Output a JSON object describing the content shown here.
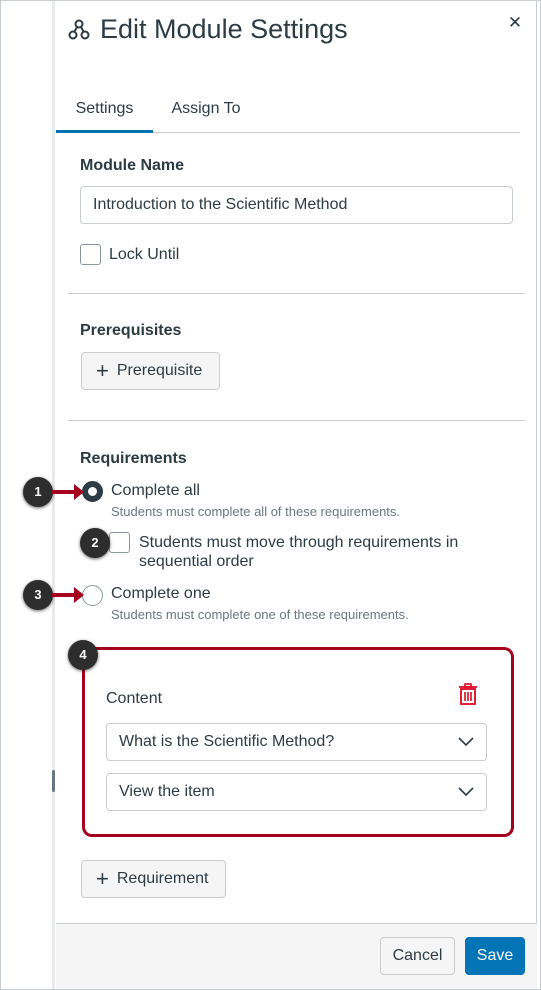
{
  "header": {
    "title": "Edit Module Settings",
    "icon": "module-icon",
    "close_icon": "close-icon"
  },
  "tabs": [
    {
      "label": "Settings",
      "active": true
    },
    {
      "label": "Assign To",
      "active": false
    }
  ],
  "module_name": {
    "label": "Module Name",
    "value": "Introduction to the Scientific Method"
  },
  "lock_until": {
    "label": "Lock Until",
    "checked": false
  },
  "prerequisites": {
    "heading": "Prerequisites",
    "add_button": "Prerequisite"
  },
  "requirements": {
    "heading": "Requirements",
    "complete_all": {
      "label": "Complete all",
      "hint": "Students must complete all of these requirements.",
      "selected": true
    },
    "sequential": {
      "line1": "Students must move through requirements in",
      "line2": "sequential order",
      "checked": false
    },
    "complete_one": {
      "label": "Complete one",
      "hint": "Students must complete one of these requirements.",
      "selected": false
    },
    "content": {
      "label": "Content",
      "item_value": "What is the Scientific Method?",
      "action_value": "View the item",
      "delete_icon": "trash-icon"
    },
    "add_button": "Requirement"
  },
  "callouts": [
    "1",
    "2",
    "3",
    "4"
  ],
  "footer": {
    "cancel_label": "Cancel",
    "save_label": "Save"
  },
  "colors": {
    "accent": "#0374b5",
    "callout_red": "#a5001e",
    "text": "#2d3b45",
    "border": "#c7cdd1",
    "delete": "#e0061f"
  }
}
